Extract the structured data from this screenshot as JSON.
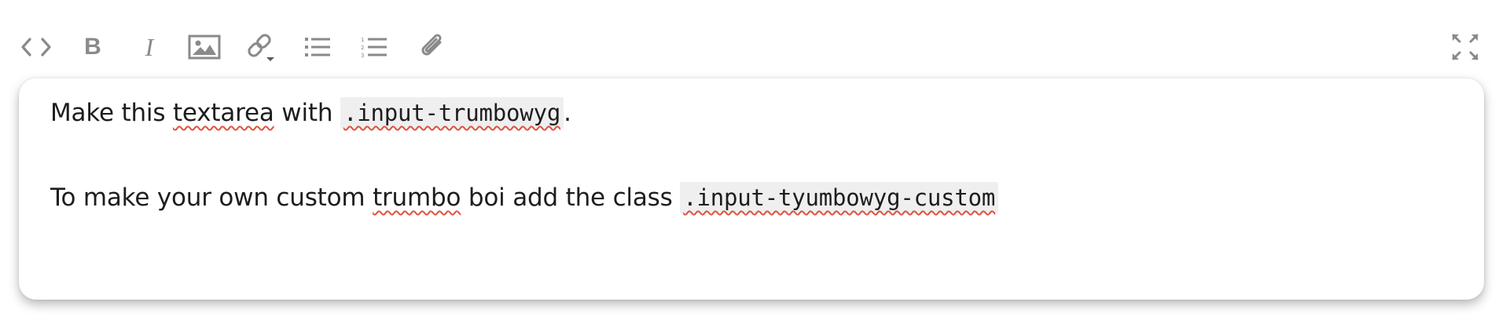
{
  "toolbar": {
    "buttons": [
      {
        "name": "source-code-icon",
        "label": "<>"
      },
      {
        "name": "bold-icon",
        "label": "B"
      },
      {
        "name": "italic-icon",
        "label": "I"
      },
      {
        "name": "image-icon",
        "label": ""
      },
      {
        "name": "link-icon",
        "label": ""
      },
      {
        "name": "unordered-list-icon",
        "label": ""
      },
      {
        "name": "ordered-list-icon",
        "label": ""
      },
      {
        "name": "attachment-icon",
        "label": ""
      },
      {
        "name": "fullscreen-icon",
        "label": ""
      }
    ],
    "icon_color": "#8a8a8a"
  },
  "content": {
    "p1": {
      "t1": "Make this ",
      "t2": "textarea",
      "t3": " with ",
      "code": ".input-trumbowyg",
      "t4": "."
    },
    "p2": {
      "t1": "To make your own custom ",
      "t2": "trumbo",
      "t3": " boi add the class ",
      "code": ".input-tyumbowyg-custom"
    }
  },
  "colors": {
    "spellcheck": "#e0533f",
    "code_bg": "#efefef",
    "text": "#1d1d1d"
  }
}
